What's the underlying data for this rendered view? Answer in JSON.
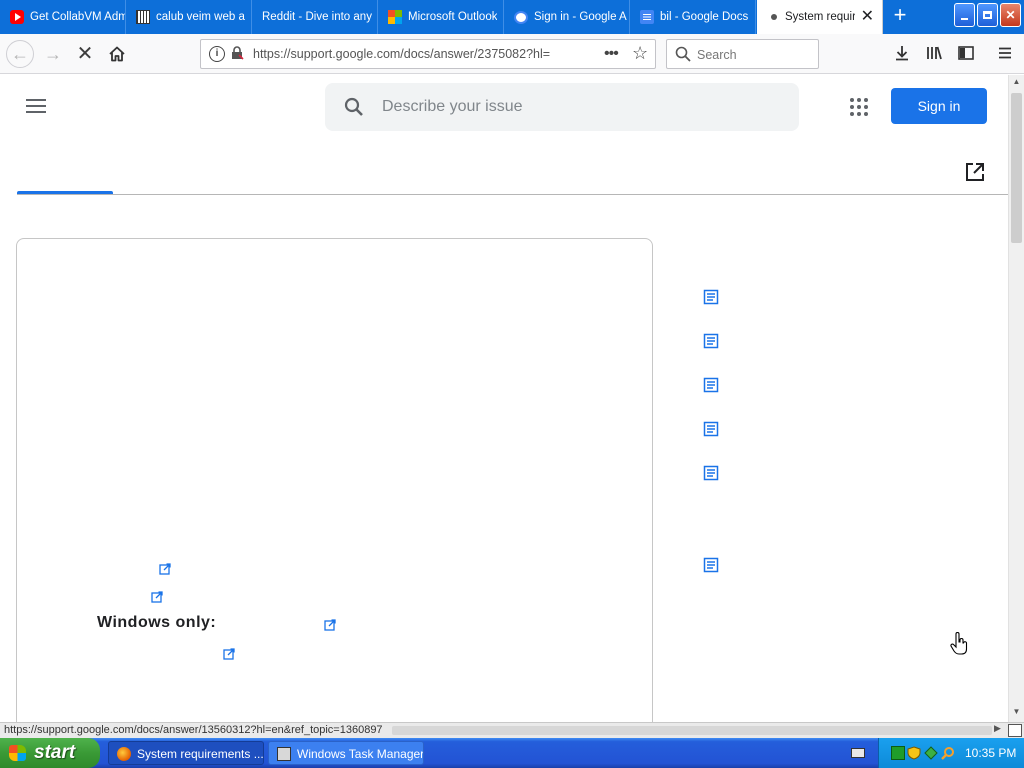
{
  "browser": {
    "tabs": [
      {
        "title": "Get CollabVM Adm",
        "icon": "youtube-icon",
        "active": false
      },
      {
        "title": "calub veim web a",
        "icon": "grid-favicon",
        "active": false
      },
      {
        "title": "Reddit - Dive into any",
        "icon": "none",
        "active": false
      },
      {
        "title": "Microsoft Outlook",
        "icon": "microsoft-icon",
        "active": false
      },
      {
        "title": "Sign in - Google A",
        "icon": "google-icon",
        "active": false
      },
      {
        "title": "bil - Google Docs",
        "icon": "docs-icon",
        "active": false
      },
      {
        "title": "System requir",
        "icon": "loading-icon",
        "active": true
      }
    ],
    "url": "https://support.google.com/docs/answer/2375082?hl=",
    "search_placeholder": "Search",
    "status_url": "https://support.google.com/docs/answer/13560312?hl=en&ref_topic=1360897"
  },
  "page": {
    "search_placeholder": "Describe your issue",
    "sign_in_label": "Sign in",
    "windows_only_label": "Windows only:"
  },
  "taskbar": {
    "start_label": "start",
    "tasks": [
      {
        "label": "System requirements ...",
        "active": true
      },
      {
        "label": "Windows Task Manager",
        "active": false
      }
    ],
    "clock": "10:35 PM"
  },
  "colors": {
    "titlebar_blue": "#0d6fd9",
    "accent_blue": "#1a73e8",
    "taskbar_blue": "#245edb",
    "start_green": "#3a9a36"
  }
}
